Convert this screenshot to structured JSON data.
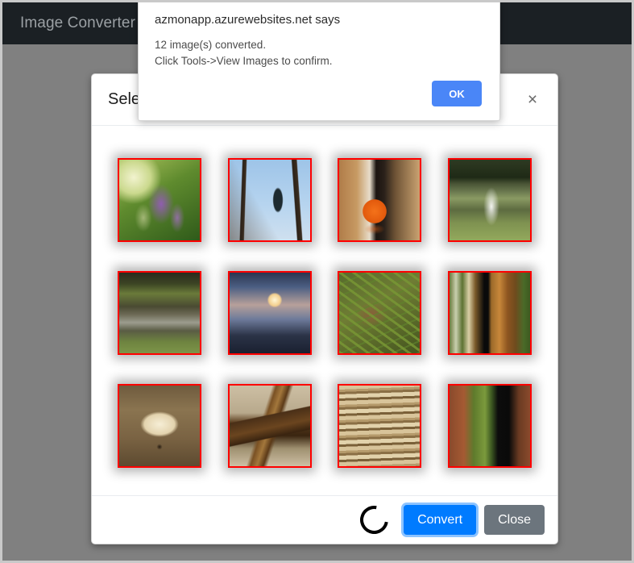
{
  "navbar": {
    "brand": "Image Converter"
  },
  "alert": {
    "origin_text": "azmonapp.azurewebsites.net says",
    "message_line1": "12 image(s) converted.",
    "message_line2": "Click Tools->View Images to confirm.",
    "ok_label": "OK",
    "button_color": "#4a86f7"
  },
  "modal": {
    "title": "Select Images",
    "close_icon": "close-icon",
    "close_glyph": "×",
    "footer": {
      "spinner_icon": "loading-spinner-icon",
      "convert_label": "Convert",
      "close_label": "Close",
      "convert_color": "#007bff",
      "close_color": "#6c757d"
    },
    "thumbnails": [
      {
        "name": "purple-flower-spike",
        "art": "art-flower",
        "selected": true
      },
      {
        "name": "cormorant-in-bare-tree",
        "art": "art-bird",
        "selected": true
      },
      {
        "name": "orange-on-table",
        "art": "art-orange",
        "selected": true
      },
      {
        "name": "garden-fountain-pond",
        "art": "art-fountain",
        "selected": true
      },
      {
        "name": "woodland-pond",
        "art": "art-pond",
        "selected": true
      },
      {
        "name": "sunset-through-trees",
        "art": "art-sunset",
        "selected": true
      },
      {
        "name": "grass-and-leaves",
        "art": "art-grass",
        "selected": true
      },
      {
        "name": "grilled-food-plate",
        "art": "art-food",
        "selected": true
      },
      {
        "name": "ceiling-lamp",
        "art": "art-lamp",
        "selected": true
      },
      {
        "name": "wooden-stool-top",
        "art": "art-stool",
        "selected": true
      },
      {
        "name": "stacked-books-edges",
        "art": "art-books",
        "selected": true
      },
      {
        "name": "lizard-by-tree",
        "art": "art-lizard",
        "selected": true
      }
    ],
    "selection_border_color": "#ff0000"
  }
}
